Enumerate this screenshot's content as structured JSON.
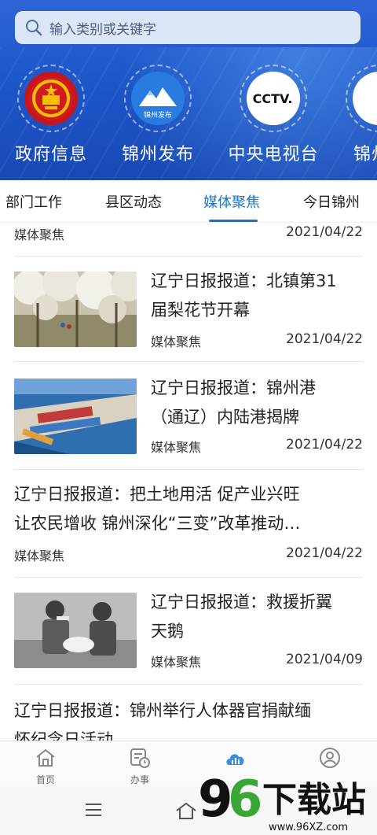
{
  "search": {
    "placeholder": "输入类别或关键字"
  },
  "channels": [
    {
      "label": "政府信息",
      "icon": "national-emblem-icon"
    },
    {
      "label": "锦州发布",
      "icon": "jinzhou-release-icon",
      "logo_text": "锦州发布"
    },
    {
      "label": "中央电视台",
      "icon": "cctv-icon",
      "logo_text": "CCTV."
    },
    {
      "label": "锦州",
      "icon": "partial-channel-icon"
    }
  ],
  "tabs": [
    {
      "label": "部门工作",
      "active": false
    },
    {
      "label": "县区动态",
      "active": false
    },
    {
      "label": "媒体聚焦",
      "active": true
    },
    {
      "label": "今日锦州",
      "active": false
    }
  ],
  "articles": [
    {
      "title": "",
      "source": "媒体聚焦",
      "date": "2021/04/22"
    },
    {
      "title_line1": "辽宁日报报道：北镇第31",
      "title_line2": "届梨花节开幕",
      "source": "媒体聚焦",
      "date": "2021/04/22",
      "thumb": "pear-blossom-orchard"
    },
    {
      "title_line1": "辽宁日报报道：锦州港",
      "title_line2": "（通辽）内陆港揭牌",
      "source": "媒体聚焦",
      "date": "2021/04/22",
      "thumb": "port-aerial"
    },
    {
      "title_line1": "辽宁日报报道：把土地用活 促产业兴旺",
      "title_line2": "让农民增收 锦州深化“三变”改革推动…",
      "source": "媒体聚焦",
      "date": "2021/04/22"
    },
    {
      "title_line1": "辽宁日报报道：救援折翼",
      "title_line2": "天鹅",
      "source": "媒体聚焦",
      "date": "2021/04/09",
      "thumb": "swan-rescue"
    },
    {
      "title_line1": "辽宁日报报道：锦州举行人体器官捐献缅",
      "title_line2": "怀纪念日活动"
    }
  ],
  "bottom_nav": [
    {
      "label": "首页",
      "icon": "home-icon"
    },
    {
      "label": "办事",
      "icon": "services-icon"
    },
    {
      "label": "",
      "icon": "cloud-chart-icon",
      "active": true
    },
    {
      "label": "",
      "icon": "user-icon"
    }
  ],
  "watermark": {
    "text": "96下载站",
    "url_text": "www.96XZ.com"
  },
  "colors": {
    "header_blue": "#1d56c9",
    "accent": "#1a73c9"
  }
}
